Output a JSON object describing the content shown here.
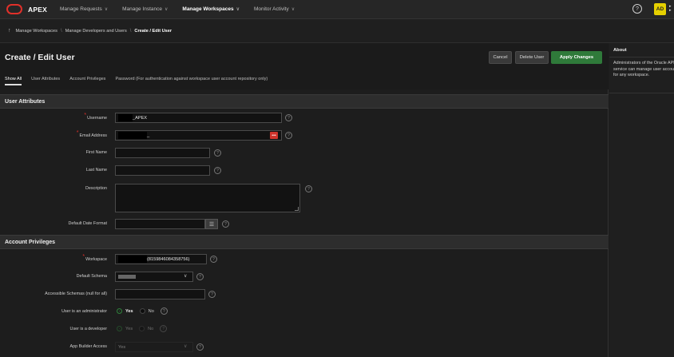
{
  "topbar": {
    "brand": "APEX",
    "menu": [
      "Manage Requests",
      "Manage Instance",
      "Manage Workspaces",
      "Monitor Activity"
    ],
    "help": "?",
    "avatar": "AD"
  },
  "breadcrumb": [
    "Manage Workspaces",
    "Manage Developers and Users",
    "Create / Edit User"
  ],
  "page": {
    "title": "Create / Edit User",
    "buttons": {
      "cancel": "Cancel",
      "delete": "Delete User",
      "apply": "Apply Changes"
    },
    "tabs": [
      "Show All",
      "User Attributes",
      "Account Privileges",
      "Password (For authentication against workspace user account repository only)"
    ]
  },
  "user_attributes": {
    "heading": "User Attributes",
    "username_label": "Username",
    "username_value": "_APEX",
    "email_label": "Email Address",
    "email_value": "_",
    "first_name_label": "First Name",
    "last_name_label": "Last Name",
    "description_label": "Description",
    "date_format_label": "Default Date Format"
  },
  "account_privileges": {
    "heading": "Account Privileges",
    "workspace_label": "Workspace",
    "workspace_value": "(8159846084358756)",
    "default_schema_label": "Default Schema",
    "accessible_schemas_label": "Accessible Schemas (null for all)",
    "administrator_label": "User is an administrator",
    "developer_label": "User is a developer",
    "app_builder_label": "App Builder Access",
    "app_builder_value": "Yes",
    "yes": "Yes",
    "no": "No"
  },
  "about": {
    "heading": "About",
    "text": "Administrators of the Oracle APEX service can manage user accounts for any workspace."
  },
  "colors": {
    "accent_green": "#2f7a3a",
    "required_red": "#e0302a",
    "avatar_yellow": "#e6d000"
  }
}
